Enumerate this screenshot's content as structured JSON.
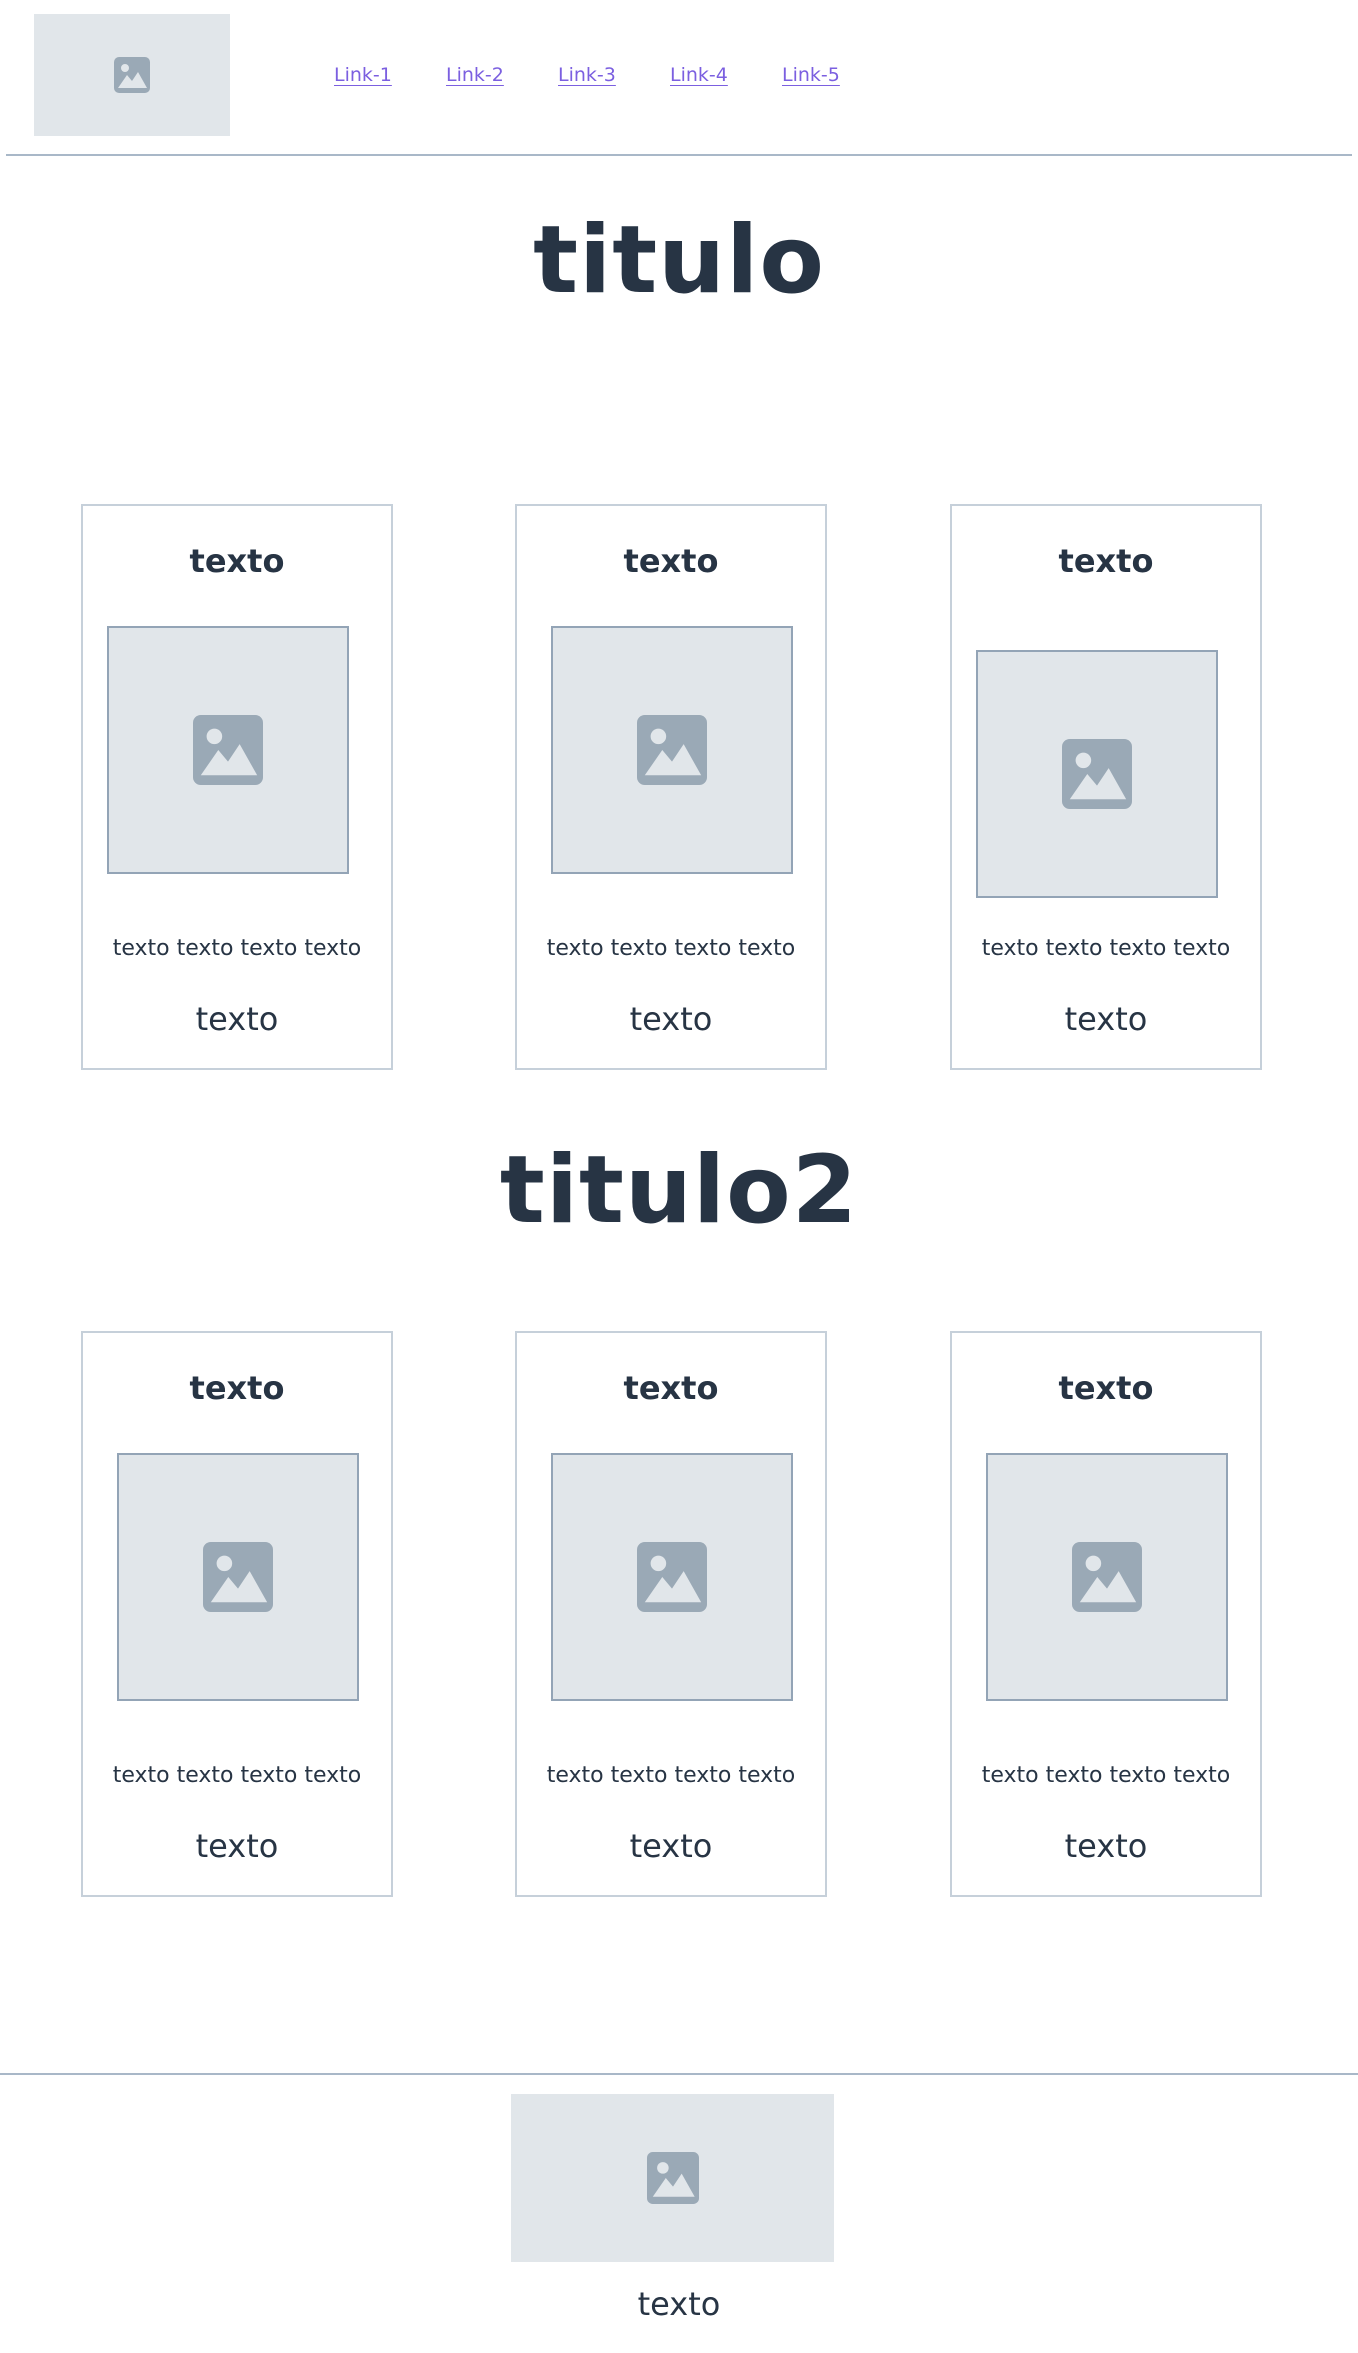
{
  "header": {
    "logo_icon": "image-placeholder-icon",
    "links": [
      "Link-1",
      "Link-2",
      "Link-3",
      "Link-4",
      "Link-5"
    ],
    "link_color": "#7b5fe0"
  },
  "section1": {
    "title": "titulo",
    "cards": [
      {
        "heading": "texto",
        "image_icon": "image-placeholder-icon",
        "text": "texto texto texto texto",
        "footer": "texto"
      },
      {
        "heading": "texto",
        "image_icon": "image-placeholder-icon",
        "text": "texto texto texto texto",
        "footer": "texto"
      },
      {
        "heading": "texto",
        "image_icon": "image-placeholder-icon",
        "text": "texto texto texto texto",
        "footer": "texto"
      }
    ]
  },
  "section2": {
    "title": "titulo2",
    "cards": [
      {
        "heading": "texto",
        "image_icon": "image-placeholder-icon",
        "text": "texto texto texto texto",
        "footer": "texto"
      },
      {
        "heading": "texto",
        "image_icon": "image-placeholder-icon",
        "text": "texto texto texto texto",
        "footer": "texto"
      },
      {
        "heading": "texto",
        "image_icon": "image-placeholder-icon",
        "text": "texto texto texto texto",
        "footer": "texto"
      }
    ]
  },
  "footer": {
    "image_icon": "image-placeholder-icon",
    "text": "texto"
  },
  "colors": {
    "text": "#273444",
    "placeholder_bg": "#e1e6ea",
    "placeholder_icon": "#9aa9b6",
    "card_border": "#c6d0da"
  }
}
